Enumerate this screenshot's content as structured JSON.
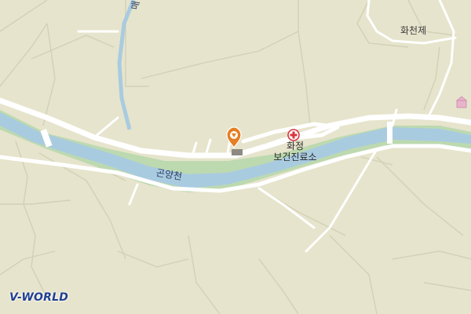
{
  "map": {
    "labels": {
      "reservoir": "화천제",
      "health_center_line1": "화정",
      "health_center_line2": "보건진료소",
      "river": "곤양천",
      "stream_partial": "매"
    },
    "colors": {
      "land": "#e6e4cc",
      "water": "#a9cbe0",
      "riverbank": "#bcd9b0",
      "road": "#ffffff",
      "contour": "#d2d0b6",
      "pin": "#e67e22"
    },
    "markers": {
      "location_pin": "location-pin-icon",
      "health_center": "hospital-cross-icon"
    }
  },
  "branding": {
    "logo_prefix": "V",
    "logo_suffix": "-WORLD"
  }
}
